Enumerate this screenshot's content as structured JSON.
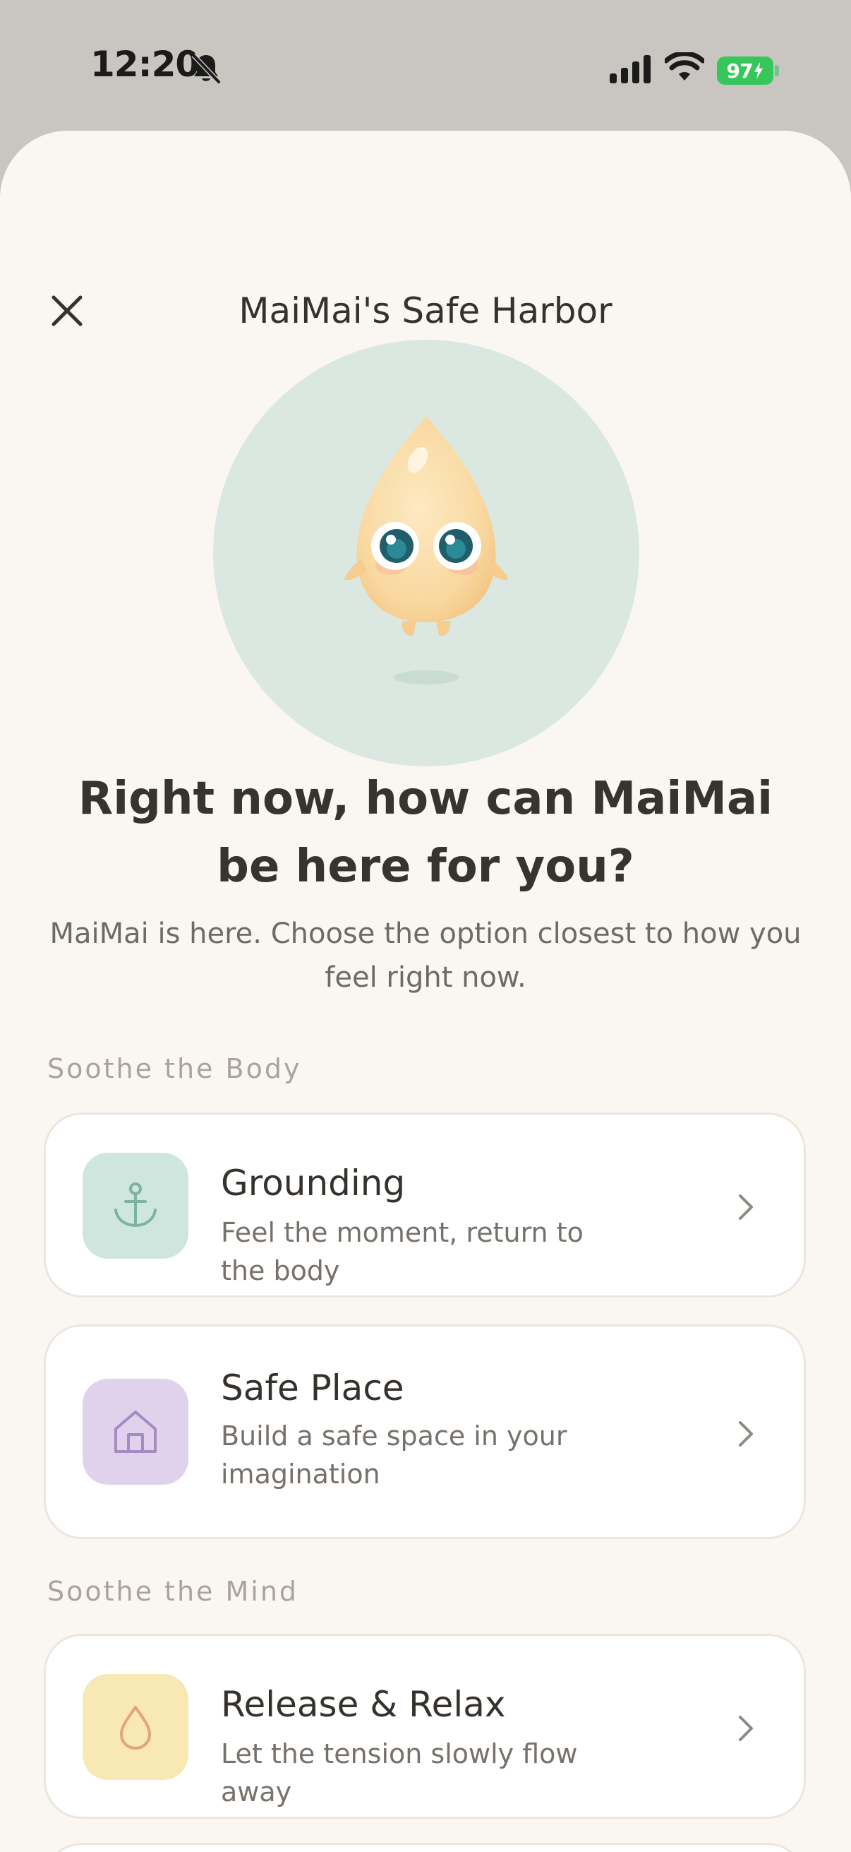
{
  "status_bar": {
    "time": "12:20",
    "battery": "97"
  },
  "header": {
    "title": "MaiMai's Safe Harbor"
  },
  "hero": {
    "headline": "Right now, how can MaiMai be here for you?",
    "subtitle": "MaiMai is here. Choose the option closest to how you feel right now."
  },
  "sections": [
    {
      "label": "Soothe the Body",
      "options": [
        {
          "title": "Grounding",
          "description": "Feel the moment, return to the body",
          "icon": "anchor-icon",
          "tile_color": "#cfe6df",
          "icon_color": "#7cb3a3"
        },
        {
          "title": "Safe Place",
          "description": "Build a safe space in your imagination",
          "icon": "house-icon",
          "tile_color": "#e0d2ec",
          "icon_color": "#a48bc1"
        }
      ]
    },
    {
      "label": "Soothe the Mind",
      "options": [
        {
          "title": "Release & Relax",
          "description": "Let the tension slowly flow away",
          "icon": "droplet-icon",
          "tile_color": "#f7e8b4",
          "icon_color": "#e0a67a"
        }
      ]
    }
  ],
  "colors": {
    "background": "#faf7f3",
    "status_area": "#c9c6c2",
    "mascot_circle": "#dbe8e2",
    "battery": "#36c75a"
  }
}
